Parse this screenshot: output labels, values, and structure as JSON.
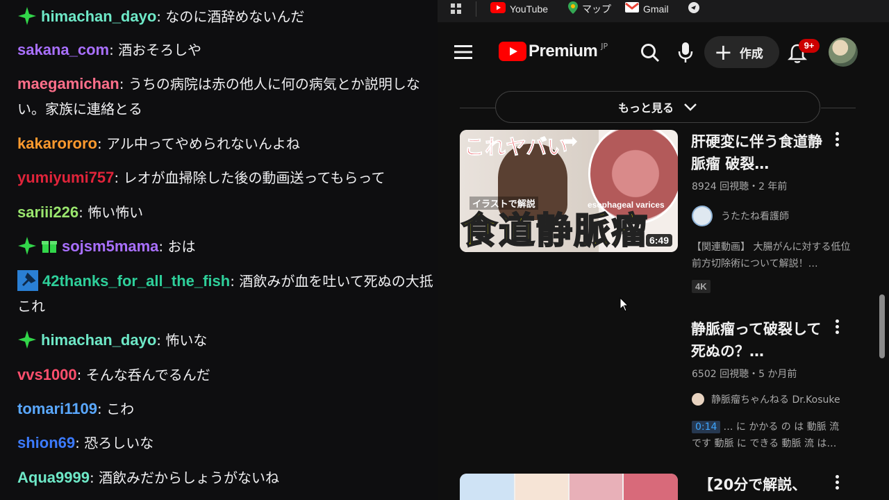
{
  "chat": {
    "messages": [
      {
        "badges": [
          "sparkle"
        ],
        "user": "himachan_dayo",
        "color": "#6ee8c7",
        "text": "なのに酒辞めないんだ"
      },
      {
        "badges": [],
        "user": "sakana_com",
        "color": "#a970ff",
        "text": "酒おそろしや"
      },
      {
        "badges": [],
        "user": "maegamichan",
        "color": "#ff6f8a",
        "text": "うちの病院は赤の他人に何の病気とか説明しない。家族に連絡とる"
      },
      {
        "badges": [],
        "user": "kakarororo",
        "color": "#ff9a2e",
        "text": "アル中ってやめられないんよね"
      },
      {
        "badges": [],
        "user": "yumiyumi757",
        "color": "#e0243a",
        "text": "レオが血掃除した後の動画送ってもらって"
      },
      {
        "badges": [],
        "user": "sariii226",
        "color": "#9ae66e",
        "text": "怖い怖い"
      },
      {
        "badges": [
          "sparkle",
          "gift"
        ],
        "user": "sojsm5mama",
        "color": "#a970ff",
        "text": "おは"
      },
      {
        "badges": [
          "tool"
        ],
        "user": "42thanks_for_all_the_fish",
        "color": "#2ecf9a",
        "text": "酒飲みが血を吐いて死ぬの大抵これ"
      },
      {
        "badges": [
          "sparkle"
        ],
        "user": "himachan_dayo",
        "color": "#6ee8c7",
        "text": "怖いな"
      },
      {
        "badges": [],
        "user": "vvs1000",
        "color": "#ff4f6d",
        "text": "そんな呑んでるんだ"
      },
      {
        "badges": [],
        "user": "tomari1109",
        "color": "#5aa8ff",
        "text": "こわ"
      },
      {
        "badges": [],
        "user": "shion69",
        "color": "#3c7bff",
        "text": "恐ろしいな"
      },
      {
        "badges": [],
        "user": "Aqua9999",
        "color": "#6ee8c7",
        "text": "酒飲みだからしょうがないね"
      }
    ]
  },
  "browser": {
    "bookmarks": [
      {
        "label": "YouTube",
        "icon": "youtube-icon"
      },
      {
        "label": "マップ",
        "icon": "maps-icon"
      },
      {
        "label": "Gmail",
        "icon": "gmail-icon"
      }
    ],
    "header": {
      "logo_text": "Premium",
      "region": "JP",
      "create_label": "作成",
      "notification_count": "9+"
    },
    "more_label": "もっと見る",
    "videos": [
      {
        "title": "肝硬変に伴う食道静脈瘤 破裂…",
        "meta": "8924 回視聴・2 年前",
        "channel": "うたたね看護師",
        "description": "【関連動画】 大腸がんに対する低位前方切除術について解説！…",
        "badge": "4K",
        "duration": "6:49",
        "thumb_text_top": "これヤバい",
        "thumb_text_mid": "イラストで解説",
        "thumb_text_en": "esophageal varices",
        "thumb_text_big": "食道静脈瘤"
      },
      {
        "title": "静脈瘤って破裂して死ぬの？…",
        "meta": "6502 回視聴・5 か月前",
        "channel": "静脈瘤ちゃんねる Dr.Kosuke",
        "timestamp": "0:14",
        "snippet_1": "… に かかる の は 動脈 流",
        "snippet_2": "です 動脈 に できる 動脈 流 は…"
      },
      {
        "title": "【20分で解説、"
      }
    ],
    "colors": {
      "brand_red": "#ff0000",
      "notif_red": "#cc0000"
    }
  }
}
